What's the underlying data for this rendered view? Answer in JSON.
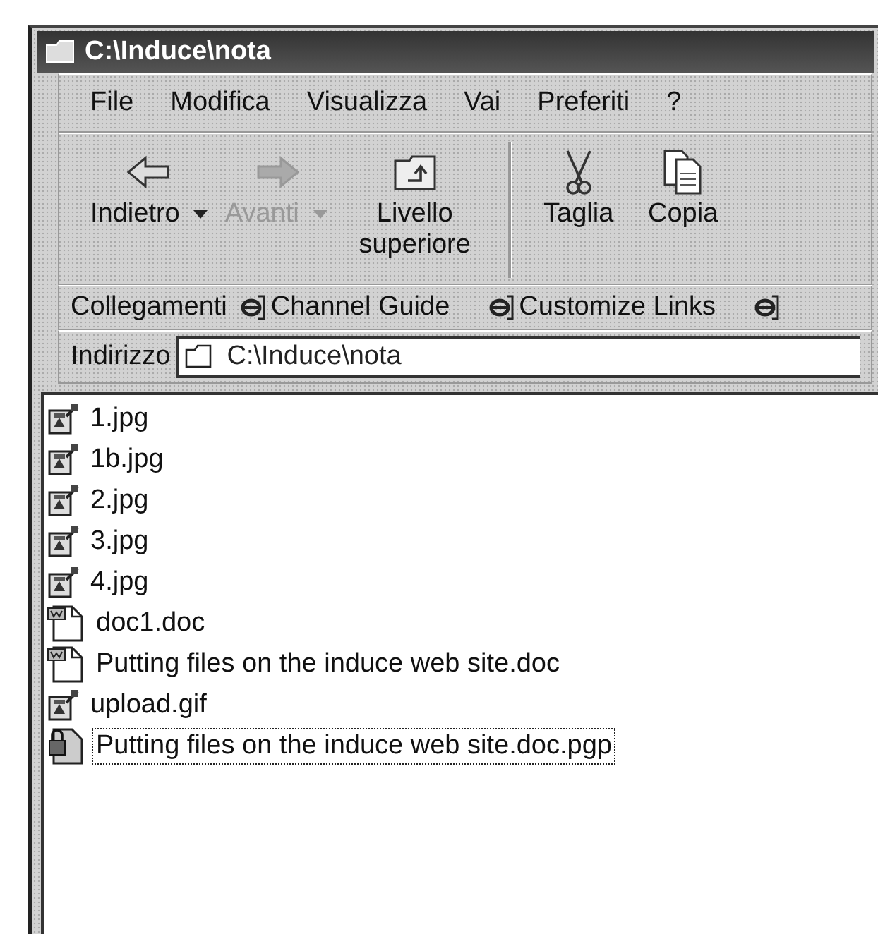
{
  "window": {
    "title": "C:\\Induce\\nota"
  },
  "menu": [
    {
      "label": "File"
    },
    {
      "label": "Modifica"
    },
    {
      "label": "Visualizza"
    },
    {
      "label": "Vai"
    },
    {
      "label": "Preferiti"
    },
    {
      "label": "?"
    }
  ],
  "toolbar": [
    {
      "kind": "back",
      "label": "Indietro",
      "disabled": false,
      "dropdown": true
    },
    {
      "kind": "forward",
      "label": "Avanti",
      "disabled": true,
      "dropdown": true
    },
    {
      "kind": "up",
      "label": "Livello superiore",
      "disabled": false,
      "dropdown": false
    },
    {
      "kind": "separator"
    },
    {
      "kind": "cut",
      "label": "Taglia",
      "disabled": false,
      "dropdown": false
    },
    {
      "kind": "copy",
      "label": "Copia",
      "disabled": false,
      "dropdown": false
    }
  ],
  "links": {
    "label": "Collegamenti",
    "items": [
      {
        "kind": "link",
        "label": "Channel Guide"
      },
      {
        "kind": "link",
        "label": "Customize Links"
      },
      {
        "kind": "icon"
      }
    ]
  },
  "address": {
    "label": "Indirizzo",
    "value": "C:\\Induce\\nota"
  },
  "files": [
    {
      "name": "1.jpg",
      "kind": "image",
      "focused": false
    },
    {
      "name": "1b.jpg",
      "kind": "image",
      "focused": false
    },
    {
      "name": "2.jpg",
      "kind": "image",
      "focused": false
    },
    {
      "name": "3.jpg",
      "kind": "image",
      "focused": false
    },
    {
      "name": "4.jpg",
      "kind": "image",
      "focused": false
    },
    {
      "name": "doc1.doc",
      "kind": "document",
      "focused": false
    },
    {
      "name": "Putting files on the induce web site.doc",
      "kind": "document",
      "focused": false
    },
    {
      "name": "upload.gif",
      "kind": "image",
      "focused": false
    },
    {
      "name": "Putting files on the induce web site.doc.pgp",
      "kind": "encrypted",
      "focused": true
    }
  ]
}
